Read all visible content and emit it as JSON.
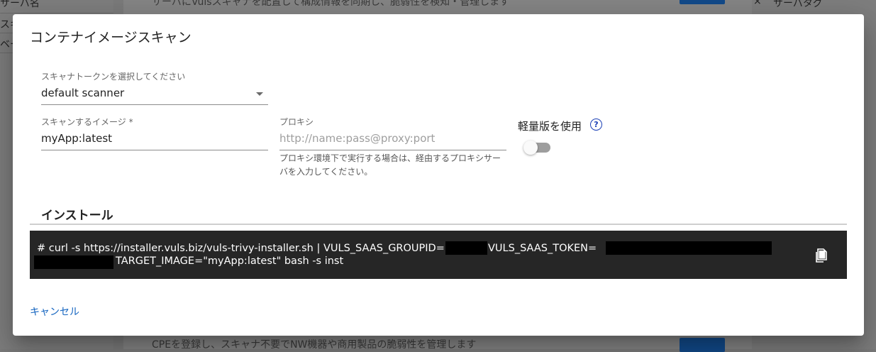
{
  "background": {
    "left_header": "サーバ名",
    "left_rows": [
      "スキ",
      "ベー"
    ],
    "top_description": "サーバにVulsスキャナを配置して構成情報を同期し、脆弱性を検知・管理します",
    "bottom_description": "CPEを登録し、スキャナ不要でNW機器や商用製品の脆弱性を管理します",
    "right_close": "×",
    "right_header": "サーバタグ"
  },
  "dialog": {
    "title": "コンテナイメージスキャン",
    "scanner_token": {
      "label": "スキャナトークンを選択してください",
      "value": "default scanner"
    },
    "image": {
      "label": "スキャンするイメージ *",
      "value": "myApp:latest"
    },
    "proxy": {
      "label": "プロキシ",
      "placeholder": "http://name:pass@proxy:port",
      "hint": "プロキシ環境下で実行する場合は、経由するプロキシサーバを入力してください。"
    },
    "lite": {
      "label": "軽量版を使用",
      "help_icon": "help-circle-icon",
      "enabled": false
    },
    "install": {
      "title": "インストール",
      "command_part1": "#   curl -s https://installer.vuls.biz/vuls-trivy-installer.sh | VULS_SAAS_GROUPID=",
      "command_part2": "VULS_SAAS_TOKEN=",
      "command_part3": "TARGET_IMAGE=\"myApp:latest\" bash -s inst",
      "copy_icon": "content-copy-icon"
    },
    "cancel_label": "キャンセル"
  },
  "colors": {
    "accent": "#1565c0",
    "code_background": "#262626",
    "help_icon": "#1a3fb5"
  }
}
